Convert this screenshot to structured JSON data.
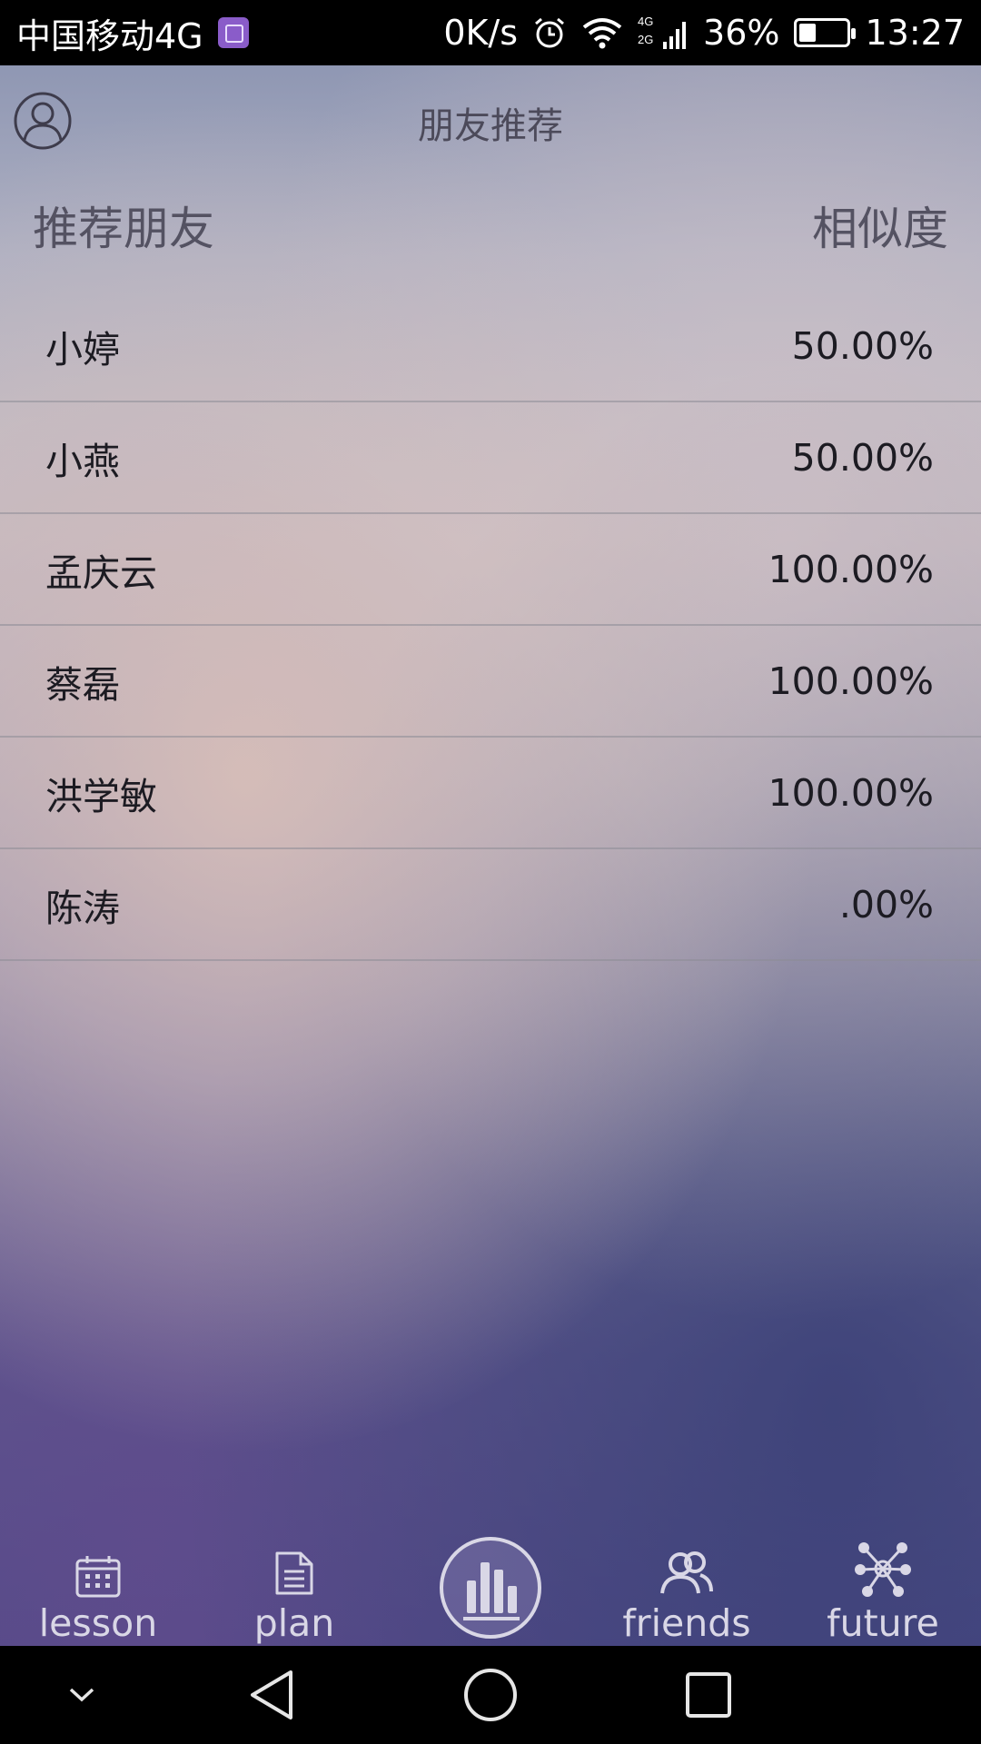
{
  "status_bar": {
    "carrier": "中国移动4G",
    "speed": "0K/s",
    "network": "4G",
    "network2": "2G",
    "battery": "36%",
    "battery_level": 0.36,
    "time": "13:27"
  },
  "header": {
    "title": "朋友推荐",
    "profile_icon": "person-circle-icon"
  },
  "list": {
    "col_name": "推荐朋友",
    "col_similarity": "相似度",
    "rows": [
      {
        "name": "小婷",
        "similarity": "50.00%"
      },
      {
        "name": "小燕",
        "similarity": "50.00%"
      },
      {
        "name": "孟庆云",
        "similarity": "100.00%"
      },
      {
        "name": "蔡磊",
        "similarity": "100.00%"
      },
      {
        "name": "洪学敏",
        "similarity": "100.00%"
      },
      {
        "name": "陈涛",
        "similarity": ".00%"
      }
    ]
  },
  "tabs": [
    {
      "label": "lesson",
      "icon": "calendar-icon"
    },
    {
      "label": "plan",
      "icon": "document-icon"
    },
    {
      "label": "",
      "icon": "bar-chart-circle-icon"
    },
    {
      "label": "friends",
      "icon": "friends-icon",
      "active": true
    },
    {
      "label": "future",
      "icon": "network-icon"
    }
  ],
  "colors": {
    "active_tab": "#ff8a1e",
    "inactive_tab": "#d9d7e6",
    "title_text": "#4c4a5a"
  }
}
